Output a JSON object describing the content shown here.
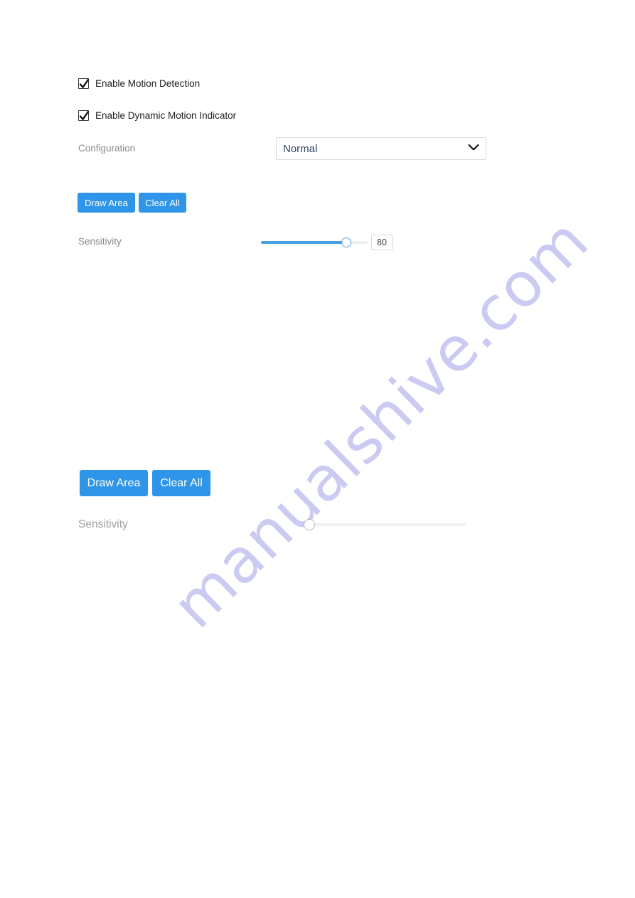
{
  "watermark": {
    "text": "manualshive.com",
    "color": "#cbcaf2"
  },
  "theme": {
    "button_blue": "#2e95e8",
    "slider_fill": "#4a9fe0",
    "slider_track": "#eceef0",
    "select_text": "#2c4a63",
    "label_gray": "#8a8a8a"
  },
  "settings_panel": {
    "checkboxes": [
      {
        "label": "Enable Motion Detection",
        "checked": true,
        "icon": "checkmark-icon"
      },
      {
        "label": "Enable Dynamic Motion Indicator",
        "checked": true,
        "icon": "checkmark-icon"
      }
    ],
    "configuration": {
      "label": "Configuration",
      "selected_value": "Normal",
      "options": [
        "Normal"
      ],
      "chevron_icon": "chevron-down-icon"
    },
    "actions_primary": {
      "draw_area_label": "Draw Area",
      "clear_all_label": "Clear All"
    },
    "sensitivity_primary": {
      "label": "Sensitivity",
      "value": "80",
      "min": 0,
      "max": 100,
      "percent": 80
    },
    "actions_secondary": {
      "draw_area_label": "Draw Area",
      "clear_all_label": "Clear All"
    },
    "sensitivity_secondary": {
      "label": "Sensitivity",
      "value": "0",
      "min": 0,
      "max": 100,
      "percent": 0
    }
  }
}
